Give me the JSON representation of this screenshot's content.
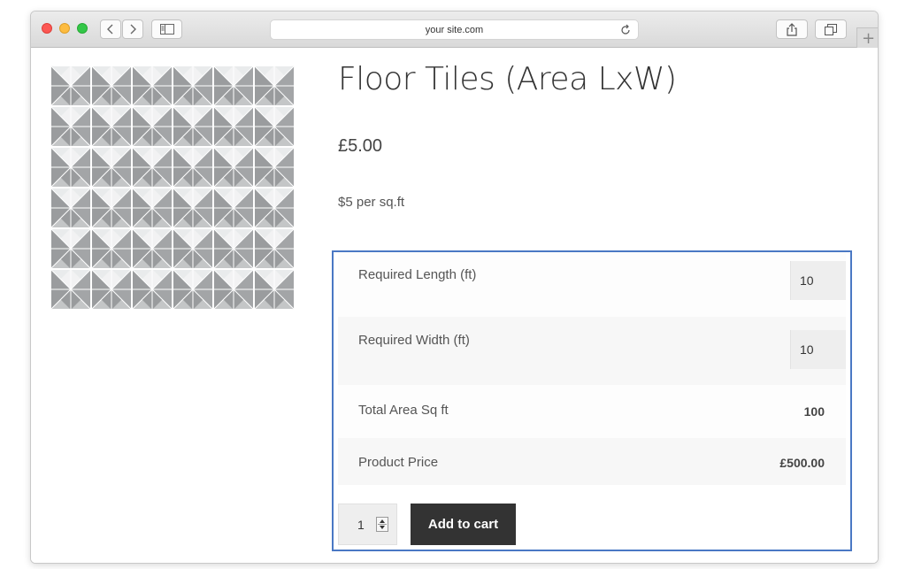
{
  "browser": {
    "url": "your site.com",
    "new_tab_label": "+"
  },
  "product": {
    "title": "Floor Tiles (Area LxW)",
    "price": "£5.00",
    "description": "$5 per sq.ft"
  },
  "calculator": {
    "length": {
      "label": "Required Length (ft)",
      "value": "10"
    },
    "width": {
      "label": "Required Width (ft)",
      "value": "10"
    },
    "total_area": {
      "label": "Total Area Sq ft",
      "value": "100"
    },
    "product_price": {
      "label": "Product Price",
      "value": "£500.00"
    }
  },
  "cart": {
    "quantity": "1",
    "add_to_cart_label": "Add to cart"
  },
  "colors": {
    "highlight_border": "#4a78c4",
    "button_bg": "#333333"
  }
}
